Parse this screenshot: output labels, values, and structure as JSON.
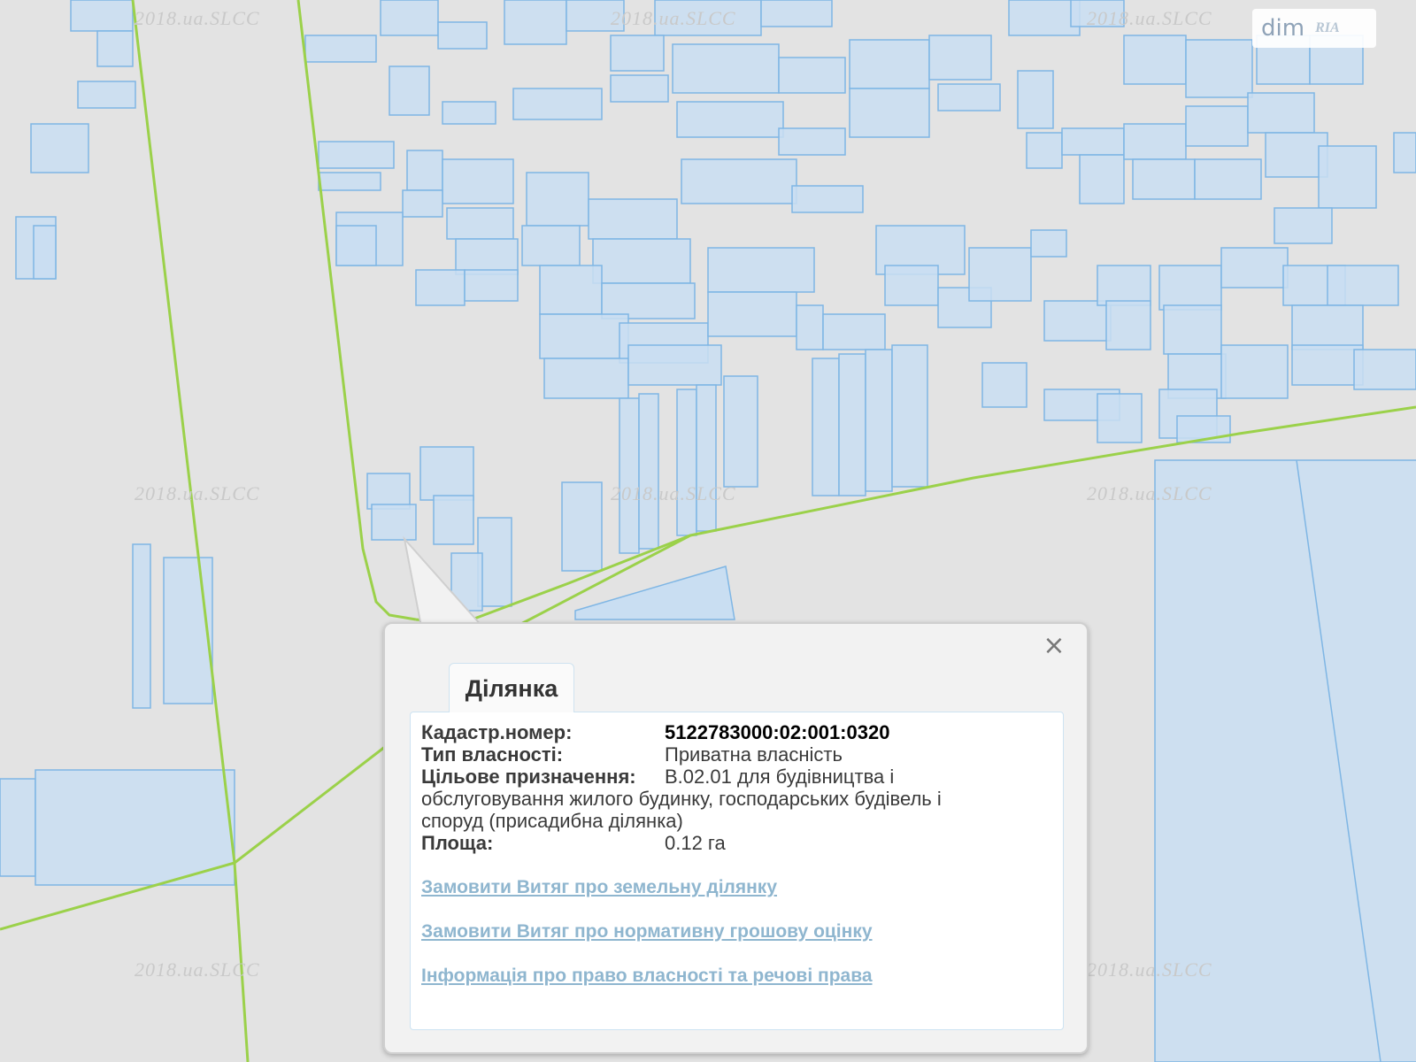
{
  "watermark_text": "2018.ua.SLCC",
  "logo": {
    "brand": "dim",
    "sub": "RIA"
  },
  "colors": {
    "background": "#e3e3e3",
    "parcel_fill": "#c9def2",
    "parcel_stroke": "#7fb6e4",
    "boundary_line": "#9bd14a",
    "link": "#8fb6cf"
  },
  "popup": {
    "tab_label": "Ділянка",
    "close_icon": "close-icon",
    "fields": [
      {
        "label": "Кадастр.номер:",
        "value": "5122783000:02:001:0320"
      },
      {
        "label": "Тип власності:",
        "value": "Приватна власність"
      },
      {
        "label": "Цільове призначення:",
        "value": "В.02.01 для будівництва і"
      },
      {
        "label": "Площа:",
        "value": "0.12 га"
      }
    ],
    "purpose_continuation": [
      "обслуговування жилого будинку, господарських будівель і",
      "споруд (присадибна ділянка)"
    ],
    "links": [
      "Замовити Витяг про земельну ділянку",
      "Замовити Витяг про нормативну грошову оцінку",
      "Інформація про право власності та речові права"
    ]
  }
}
